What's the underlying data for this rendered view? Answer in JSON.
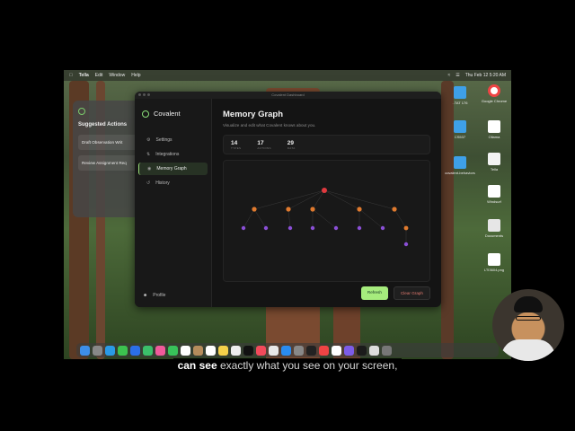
{
  "menubar": {
    "app": "Tella",
    "items": [
      "Edit",
      "Window",
      "Help"
    ],
    "datetime": "Thu Feb 12  5:20 AM"
  },
  "suggested": {
    "title": "Suggested Actions",
    "items": [
      "Draft Observation Writ",
      "Review Assignment Req"
    ]
  },
  "window": {
    "title": "Covalent Dashboard"
  },
  "sidebar": {
    "brand": "Covalent",
    "items": [
      {
        "label": "Settings",
        "icon": "gear-icon"
      },
      {
        "label": "Integrations",
        "icon": "integrations-icon"
      },
      {
        "label": "Memory Graph",
        "icon": "graph-icon",
        "active": true
      },
      {
        "label": "History",
        "icon": "history-icon"
      }
    ],
    "profile": "Profile"
  },
  "main": {
    "title": "Memory Graph",
    "subtitle": "Visualize and edit what Covalent knows about you.",
    "stats": [
      {
        "value": "14",
        "label": "TYPES"
      },
      {
        "value": "17",
        "label": "ACTIONS"
      },
      {
        "value": "29",
        "label": "DATA"
      }
    ],
    "refresh": "Refresh",
    "clear": "Clear Graph"
  },
  "desktop": {
    "icons": [
      "Google Chrome",
      "Ollama",
      "Tella",
      "Windsurf",
      "Documents",
      "LTI3604.png",
      "CS537",
      "..TAT 176",
      "covalent-behaviors"
    ]
  },
  "caption": {
    "highlight": "can see",
    "rest": "exactly what you see on your screen,"
  },
  "colors": {
    "accent": "#a6ec7d",
    "root_node": "#e0393e",
    "type_node": "#e07a2e",
    "data_node": "#8a4fd6"
  }
}
